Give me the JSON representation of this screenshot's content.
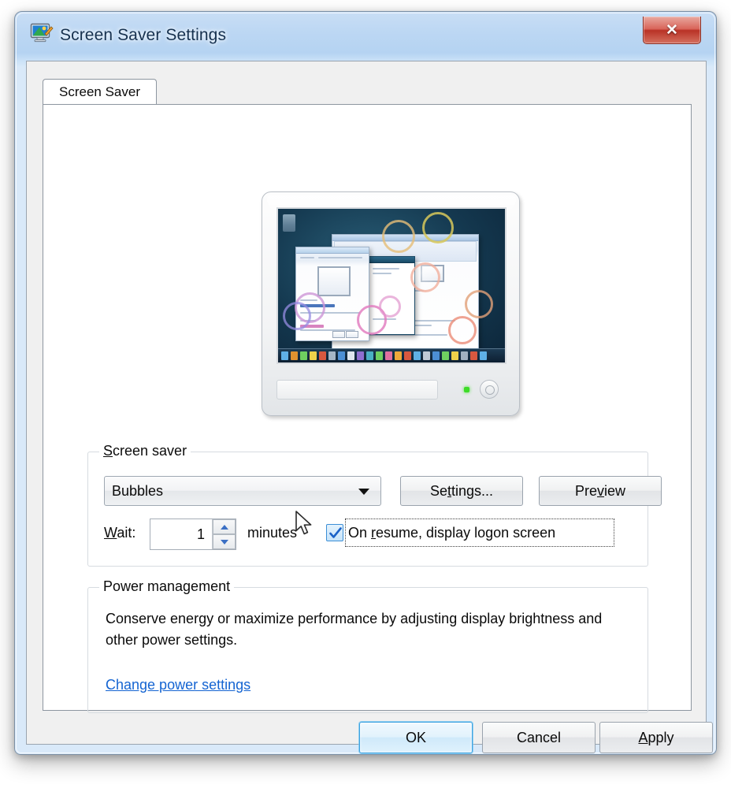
{
  "window": {
    "title": "Screen Saver Settings",
    "icon": "screen-saver-monitor-icon",
    "close_label": "✕",
    "frame_color": "#b5d3f2",
    "close_color": "#b93226"
  },
  "tabs": [
    {
      "label": "Screen Saver",
      "active": true
    }
  ],
  "preview": {
    "alt": "monitor-preview-bubbles-screensaver",
    "led_color": "#3ddc28",
    "screen_bg": "#14384f"
  },
  "screen_saver_group": {
    "title_prefix": "S",
    "title_rest": "creen saver",
    "selected": "Bubbles",
    "settings_button": {
      "pre": "Se",
      "key": "t",
      "post": "tings..."
    },
    "preview_button": {
      "pre": "Pre",
      "key": "v",
      "post": "iew"
    },
    "wait": {
      "pre": "W",
      "key": "",
      "label_prefix": "W",
      "label_rest": "ait:"
    },
    "wait_value": "1",
    "minutes_label": "minutes",
    "checkbox": {
      "checked": true,
      "pre": "On ",
      "key": "r",
      "post": "esume, display logon screen",
      "full": "On resume, display logon screen"
    }
  },
  "power_group": {
    "title": "Power management",
    "description": "Conserve energy or maximize performance by adjusting display brightness and other power settings.",
    "link": "Change power settings",
    "link_color": "#1464d2"
  },
  "footer": {
    "ok": "OK",
    "cancel": "Cancel",
    "apply_pre": "",
    "apply_key": "A",
    "apply_post": "pply",
    "apply": "Apply"
  }
}
